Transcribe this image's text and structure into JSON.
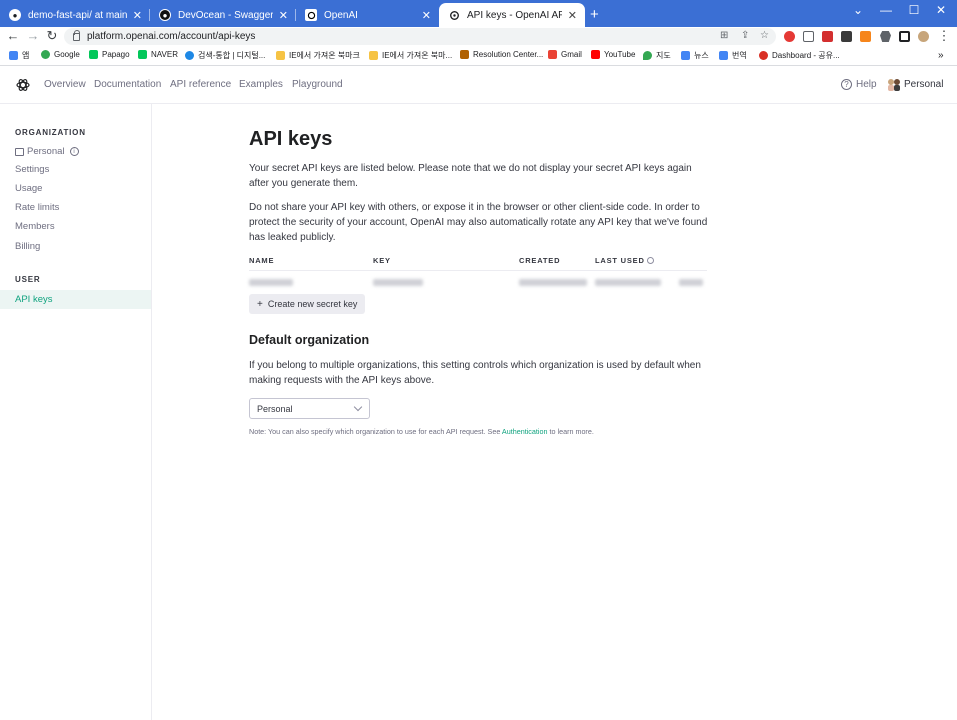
{
  "browser": {
    "tabs": [
      {
        "title": "demo-fast-api/ at main · BTSQL",
        "icon": "github-icon"
      },
      {
        "title": "DevOcean - Swagger UI",
        "icon": "devocean-icon"
      },
      {
        "title": "OpenAI",
        "icon": "openai-icon"
      },
      {
        "title": "API keys - OpenAI API",
        "icon": "openai-icon"
      }
    ],
    "new_tab": "+",
    "window_controls": {
      "minimize": "—",
      "maximize": "☐",
      "close": "✕",
      "menu": "⌄"
    },
    "url": "platform.openai.com/account/api-keys",
    "bookmarks": [
      {
        "label": "앱",
        "color": "#4285f4"
      },
      {
        "label": "Google",
        "color": "#34a853"
      },
      {
        "label": "Papago",
        "color": "#03c75a"
      },
      {
        "label": "NAVER",
        "color": "#03c75a"
      },
      {
        "label": "검색-통합 | 디지털...",
        "color": "#1e88e5"
      },
      {
        "label": "IE에서 가져온 북마크",
        "color": "#f6c344"
      },
      {
        "label": "IE에서 가져온 북마...",
        "color": "#f6c344"
      },
      {
        "label": "Resolution Center...",
        "color": "#b06000"
      },
      {
        "label": "Gmail",
        "color": "#ea4335"
      },
      {
        "label": "YouTube",
        "color": "#ff0000"
      },
      {
        "label": "지도",
        "color": "#34a853"
      },
      {
        "label": "뉴스",
        "color": "#4285f4"
      },
      {
        "label": "번역",
        "color": "#4285f4"
      },
      {
        "label": "Dashboard - 공유...",
        "color": "#d93025"
      }
    ],
    "bookmarks_overflow": "»"
  },
  "site": {
    "nav": [
      "Overview",
      "Documentation",
      "API reference",
      "Examples",
      "Playground"
    ],
    "help": "Help",
    "account": "Personal"
  },
  "sidebar": {
    "org_heading": "ORGANIZATION",
    "org_name": "Personal",
    "org_items": [
      "Settings",
      "Usage",
      "Rate limits",
      "Members",
      "Billing"
    ],
    "user_heading": "USER",
    "user_items": [
      "API keys"
    ]
  },
  "main": {
    "title": "API keys",
    "intro": "Your secret API keys are listed below. Please note that we do not display your secret API keys again after you generate them.",
    "warning": "Do not share your API key with others, or expose it in the browser or other client-side code. In order to protect the security of your account, OpenAI may also automatically rotate any API key that we've found has leaked publicly.",
    "table_headers": [
      "NAME",
      "KEY",
      "CREATED",
      "LAST USED"
    ],
    "create_button": "Create new secret key",
    "default_org_title": "Default organization",
    "default_org_desc": "If you belong to multiple organizations, this setting controls which organization is used by default when making requests with the API keys above.",
    "default_org_value": "Personal",
    "note_prefix": "Note: You can also specify which organization to use for each API request. See ",
    "note_link": "Authentication",
    "note_suffix": " to learn more."
  },
  "colors": {
    "accent": "#10a37f",
    "chrome_blue": "#3b6fd4"
  }
}
